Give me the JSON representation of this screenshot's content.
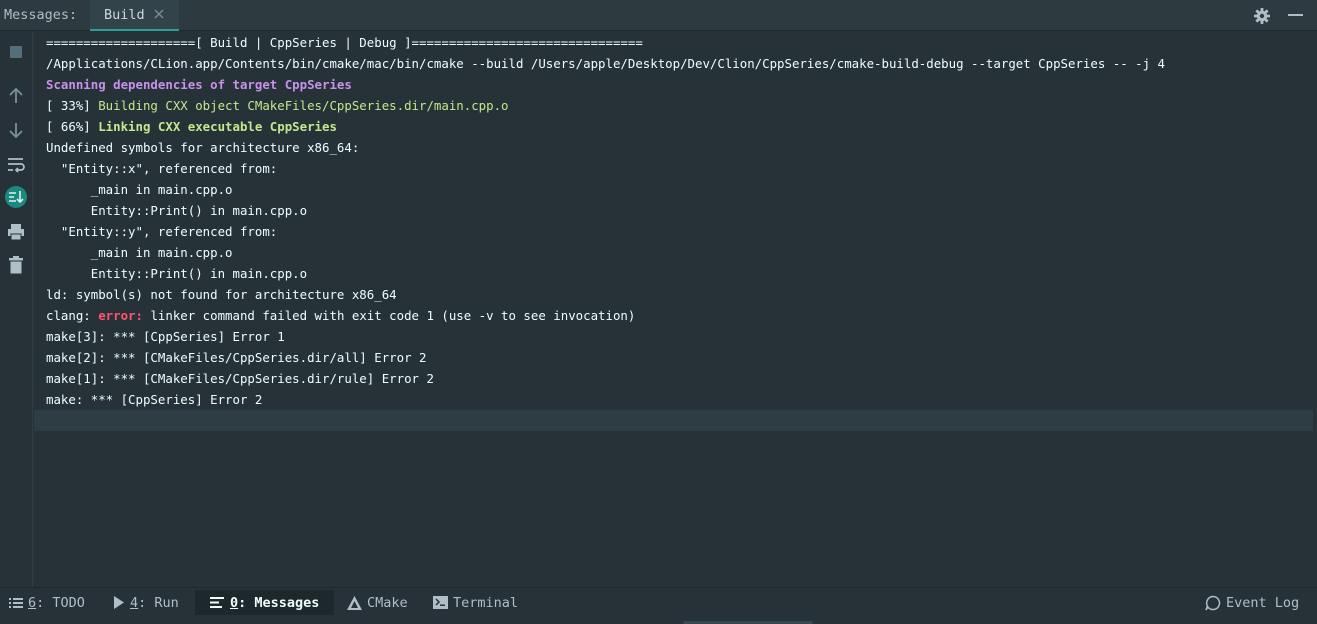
{
  "header": {
    "panel_label": "Messages:",
    "tab_label": "Build"
  },
  "side_toolbar": {
    "icons": [
      "stop-icon",
      "arrow-up-icon",
      "arrow-down-icon",
      "soft-wrap-icon",
      "scroll-to-end-icon",
      "print-icon",
      "trash-icon"
    ]
  },
  "console": {
    "lines": [
      [
        {
          "text": "====================[ Build | CppSeries | Debug ]==============================="
        }
      ],
      [
        {
          "text": "/Applications/CLion.app/Contents/bin/cmake/mac/bin/cmake --build /Users/apple/Desktop/Dev/Clion/CppSeries/cmake-build-debug --target CppSeries -- -j 4"
        }
      ],
      [
        {
          "text": "Scanning dependencies of target CppSeries",
          "style": "purple"
        }
      ],
      [
        {
          "text": "[ 33%] "
        },
        {
          "text": "Building CXX object CMakeFiles/CppSeries.dir/main.cpp.o",
          "style": "green"
        }
      ],
      [
        {
          "text": "[ 66%] "
        },
        {
          "text": "Linking CXX executable CppSeries",
          "style": "green-bold"
        }
      ],
      [
        {
          "text": "Undefined symbols for architecture x86_64:"
        }
      ],
      [
        {
          "text": "  \"Entity::x\", referenced from:"
        }
      ],
      [
        {
          "text": "      _main in main.cpp.o"
        }
      ],
      [
        {
          "text": "      Entity::Print() in main.cpp.o"
        }
      ],
      [
        {
          "text": "  \"Entity::y\", referenced from:"
        }
      ],
      [
        {
          "text": "      _main in main.cpp.o"
        }
      ],
      [
        {
          "text": "      Entity::Print() in main.cpp.o"
        }
      ],
      [
        {
          "text": "ld: symbol(s) not found for architecture x86_64"
        }
      ],
      [
        {
          "text": "clang: "
        },
        {
          "text": "error:",
          "style": "red-bold"
        },
        {
          "text": " linker command failed with exit code 1 (use -v to see invocation)"
        }
      ],
      [
        {
          "text": "make[3]: *** [CppSeries] Error 1"
        }
      ],
      [
        {
          "text": "make[2]: *** [CMakeFiles/CppSeries.dir/all] Error 2"
        }
      ],
      [
        {
          "text": "make[1]: *** [CMakeFiles/CppSeries.dir/rule] Error 2"
        }
      ],
      [
        {
          "text": "make: *** [CppSeries] Error 2"
        }
      ]
    ]
  },
  "bottom_bar": {
    "todo": {
      "key": "6",
      "label": ": TODO"
    },
    "run": {
      "key": "4",
      "label": ": Run"
    },
    "messages": {
      "key": "0",
      "label": ": Messages"
    },
    "cmake": {
      "label": "CMake"
    },
    "terminal": {
      "label": "Terminal"
    },
    "event_log": {
      "label": "Event Log"
    }
  },
  "colors": {
    "background": "#263238",
    "accent": "#2aa198",
    "purple": "#c792ea",
    "green": "#c3e88d",
    "error_red": "#ff5370"
  }
}
